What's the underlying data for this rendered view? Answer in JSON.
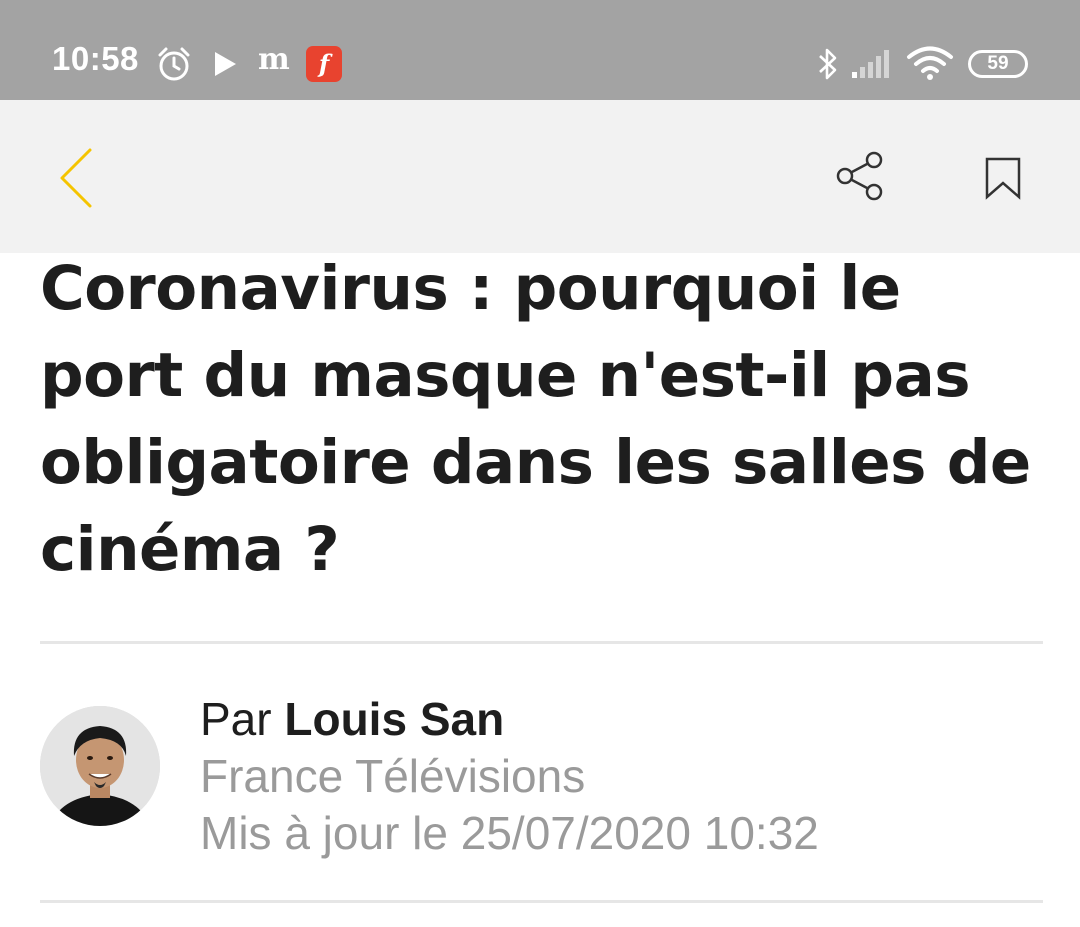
{
  "status_bar": {
    "time": "10:58",
    "icons": [
      "alarm-icon",
      "play-icon",
      "le-monde-icon",
      "franceinfo-icon",
      "bluetooth-icon",
      "signal-icon",
      "wifi-icon",
      "battery-icon"
    ],
    "monde_glyph": "m",
    "franceinfo_glyph": "f",
    "battery_level": "59",
    "background_color": "#a3a3a3"
  },
  "toolbar": {
    "back_icon": "chevron-left-icon",
    "share_icon": "share-icon",
    "bookmark_icon": "bookmark-icon",
    "accent_color": "#f5c400"
  },
  "article": {
    "title": "Coronavirus : pourquoi le port du masque n'est-il pas obligatoire dans les salles de cinéma ?",
    "byline_prefix": "Par",
    "author": "Louis San",
    "source": "France Télévisions",
    "updated": "Mis à jour le 25/07/2020 10:32"
  }
}
